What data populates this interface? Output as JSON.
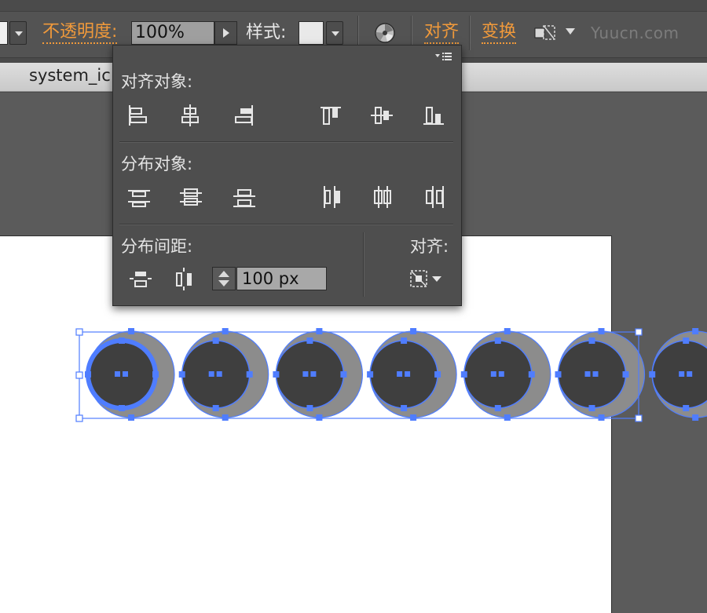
{
  "control_bar": {
    "opacity_label": "不透明度:",
    "opacity_value": "100%",
    "style_label": "样式:",
    "align_link": "对齐",
    "transform_link": "变换",
    "watermark": "Yuucn.com"
  },
  "document": {
    "tab_title": "system_ic"
  },
  "align_panel": {
    "align_objects_title": "对齐对象:",
    "distribute_objects_title": "分布对象:",
    "distribute_spacing_title": "分布间距:",
    "align_to_title": "对齐:",
    "spacing_value": "100 px",
    "align_object_buttons": [
      "horizontal-align-left",
      "horizontal-align-center",
      "horizontal-align-right",
      "vertical-align-top",
      "vertical-align-center",
      "vertical-align-bottom"
    ],
    "distribute_object_buttons": [
      "vertical-distribute-top",
      "vertical-distribute-center",
      "vertical-distribute-bottom",
      "horizontal-distribute-left",
      "horizontal-distribute-center",
      "horizontal-distribute-right"
    ],
    "spacing_buttons": [
      "vertical-distribute-space",
      "horizontal-distribute-space"
    ]
  },
  "canvas": {
    "circle_count": 7,
    "colors": {
      "selection": "#4f7dff",
      "circle_fill": "#3f3f3f",
      "shadow_fill": "#8c8c8c",
      "artboard": "#ffffff",
      "accent_link": "#f19a3b"
    }
  }
}
